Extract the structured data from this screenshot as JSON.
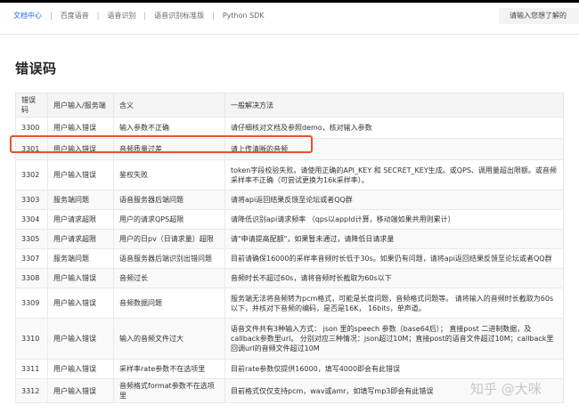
{
  "topbar": {
    "breadcrumbs": [
      "文档中心",
      "百度语音",
      "语音识别",
      "语音识别标准版",
      "Python SDK"
    ],
    "separator": "|",
    "search_placeholder": "请输入您想了解的"
  },
  "page_title": "错误码",
  "table": {
    "headers": [
      "错误码",
      "用户输入/服务端",
      "含义",
      "一般解决方法"
    ],
    "rows": [
      [
        "3300",
        "用户输入错误",
        "输入参数不正确",
        "请仔细核对文档及参照demo，核对输入参数"
      ],
      [
        "3301",
        "用户输入错误",
        "音频质量过差",
        "请上传清晰的音频"
      ],
      [
        "3302",
        "用户输入错误",
        "鉴权失败",
        "token字段校验失败。请使用正确的API_KEY 和 SECRET_KEY生成。或QPS、调用量超出限额。或音频采样率不正确（可尝试更换为16k采样率）。"
      ],
      [
        "3303",
        "服务端问题",
        "语音服务器后端问题",
        "请将api返回结果反馈至论坛或者QQ群"
      ],
      [
        "3304",
        "用户请求超限",
        "用户的请求QPS超限",
        "请降低识别api请求频率 （qps以appId计算，移动端如果共用则累计）"
      ],
      [
        "3305",
        "用户请求超限",
        "用户的日pv（日请求量）超限",
        "请\"申请提高配额\"，如果暂未通过，请降低日请求量"
      ],
      [
        "3307",
        "服务端问题",
        "语音服务器后端识别出错问题",
        "目前请确保16000的采样率音频时长低于30s。如果仍有问题，请将api返回结果反馈至论坛或者QQ群"
      ],
      [
        "3308",
        "用户输入错误",
        "音频过长",
        "音频时长不超过60s，请将音频时长截取为60s以下"
      ],
      [
        "3309",
        "用户输入错误",
        "音频数据问题",
        "服务端无法将音频转为pcm格式，可能是长度问题，音频格式问题等。 请将输入的音频时长截取为60s以下，并核对下音频的编码，是否是16K， 16bits，单声道。"
      ],
      [
        "3310",
        "用户输入错误",
        "输入的音频文件过大",
        "语音文件共有3种输入方式： json 里的speech 参数（base64后）； 直接post 二进制数据，及callback参数里url。 分别对应三种情况：json超过10M；直接post的语音文件超过10M；callback里回调url的音频文件超过10M"
      ],
      [
        "3311",
        "用户输入错误",
        "采样率rate参数不在选项里",
        "目前rate参数仅提供16000，填写4000即会有此错误"
      ],
      [
        "3312",
        "用户输入错误",
        "音频格式format参数不在选项里",
        "目前格式仅仅支持pcm，wav或amr，如填写mp3即会有此错误"
      ]
    ]
  },
  "highlight_color": "#e8532d",
  "watermark": "知乎 @大咪"
}
